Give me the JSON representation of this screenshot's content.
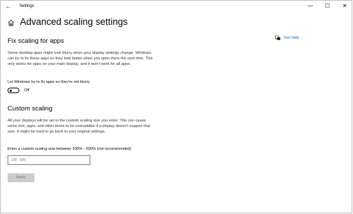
{
  "window": {
    "title": "Settings",
    "back_icon": "back-arrow-icon",
    "controls": {
      "minimize": "—",
      "maximize": "☐",
      "close": "✕"
    }
  },
  "page": {
    "title": "Advanced scaling settings",
    "home_icon": "home-icon"
  },
  "fix_scaling": {
    "heading": "Fix scaling for apps",
    "description": "Some desktop apps might look blurry when your display settings change. Windows can try to fix these apps so they look better when you open them the next time. This only works for apps on your main display, and it won't work for all apps.",
    "toggle_label": "Let Windows try to fix apps so they're not blurry",
    "toggle_state": "Off",
    "toggle_on": false
  },
  "custom_scaling": {
    "heading": "Custom scaling",
    "description": "All your displays will be set to the custom scaling size you enter. This can cause some text, apps, and other items to be unreadable if a display doesn't support that size. It might be hard to go back to your original settings.",
    "input_label": "Enter a custom scaling size between 100% - 500% (not recommended)",
    "input_placeholder": "100 - 500",
    "input_value": "",
    "apply_label": "Apply"
  },
  "help": {
    "label": "Get help",
    "icon": "help-chat-icon",
    "link_color": "#0066b4"
  }
}
